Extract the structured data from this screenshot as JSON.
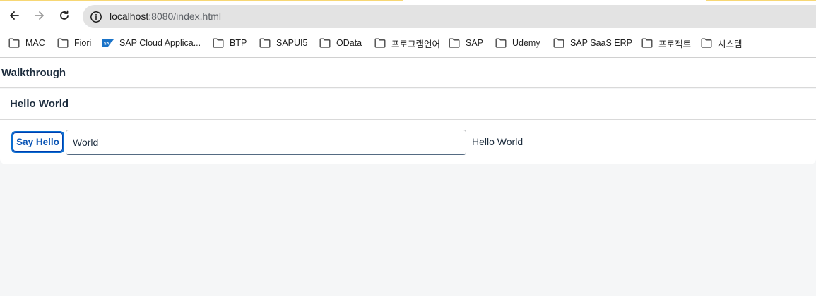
{
  "browser": {
    "url_host": "localhost",
    "url_path": ":8080/index.html",
    "loading_color": "#f7d774",
    "bookmarks": [
      {
        "label": "MAC",
        "icon": "folder-icon"
      },
      {
        "label": "Fiori",
        "icon": "folder-icon"
      },
      {
        "label": "SAP Cloud Applica...",
        "icon": "sap-logo-icon"
      },
      {
        "label": "BTP",
        "icon": "folder-icon"
      },
      {
        "label": "SAPUI5",
        "icon": "folder-icon"
      },
      {
        "label": "OData",
        "icon": "folder-icon"
      },
      {
        "label": "프로그램언어",
        "icon": "folder-icon"
      },
      {
        "label": "SAP",
        "icon": "folder-icon"
      },
      {
        "label": "Udemy",
        "icon": "folder-icon"
      },
      {
        "label": "SAP SaaS ERP",
        "icon": "folder-icon"
      },
      {
        "label": "프로젝트",
        "icon": "folder-icon"
      },
      {
        "label": "시스템",
        "icon": "folder-icon"
      }
    ]
  },
  "app": {
    "page_title": "Walkthrough",
    "panel_title": "Hello World",
    "button_label": "Say Hello",
    "input_value": "World",
    "greeting_text": "Hello World",
    "accent_color": "#0a6ed1"
  }
}
